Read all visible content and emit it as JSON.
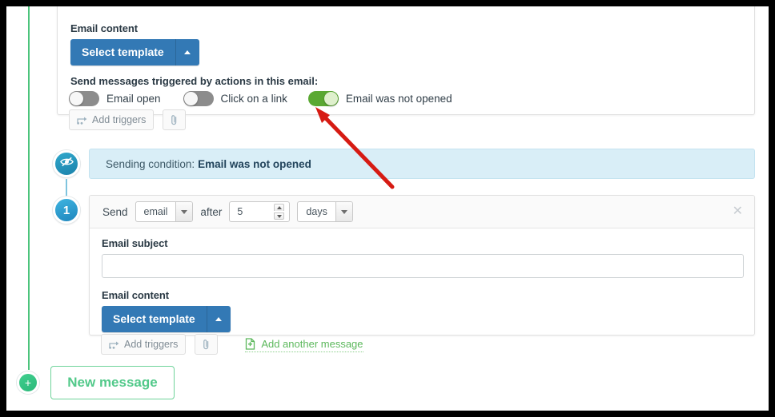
{
  "email_block": {
    "content_label": "Email content",
    "select_template_label": "Select template",
    "dropdown_caret_icon": "caret-up-icon",
    "triggers_title": "Send messages triggered by actions in this email:",
    "toggles": [
      {
        "label": "Email open",
        "state": "off"
      },
      {
        "label": "Click on a link",
        "state": "off"
      },
      {
        "label": "Email was not opened",
        "state": "on"
      }
    ],
    "actions": {
      "add_triggers_label": "Add triggers",
      "add_triggers_icon": "triggers-icon",
      "attachment_icon": "paperclip-icon"
    }
  },
  "condition": {
    "badge_icon": "eye-slash-icon",
    "prefix": "Sending condition:",
    "value": "Email was not opened"
  },
  "message": {
    "badge_number": "1",
    "head": {
      "send_label": "Send",
      "type_value": "email",
      "after_label": "after",
      "delay_value": "5",
      "unit_value": "days",
      "close_icon": "close-icon"
    },
    "subject_label": "Email subject",
    "subject_value": "",
    "subject_placeholder": "",
    "content_label": "Email content",
    "select_template_label": "Select template",
    "dropdown_caret_icon": "caret-up-icon",
    "actions": {
      "add_triggers_label": "Add triggers",
      "add_triggers_icon": "triggers-icon",
      "attachment_icon": "paperclip-icon",
      "add_another_label": "Add another message",
      "add_another_icon": "document-add-icon"
    }
  },
  "footer": {
    "plus_icon": "plus-icon",
    "new_message_label": "New message"
  },
  "annotation": {
    "arrow_icon": "red-arrow-icon",
    "color": "#d61b13"
  },
  "colors": {
    "primary_button": "#3379b5",
    "toggle_on": "#5aa832",
    "toggle_off": "#8c8c8c",
    "condition_bar": "#d9eef7",
    "green_accent": "#4cc47c",
    "badge_blue": "#2a93c4"
  }
}
